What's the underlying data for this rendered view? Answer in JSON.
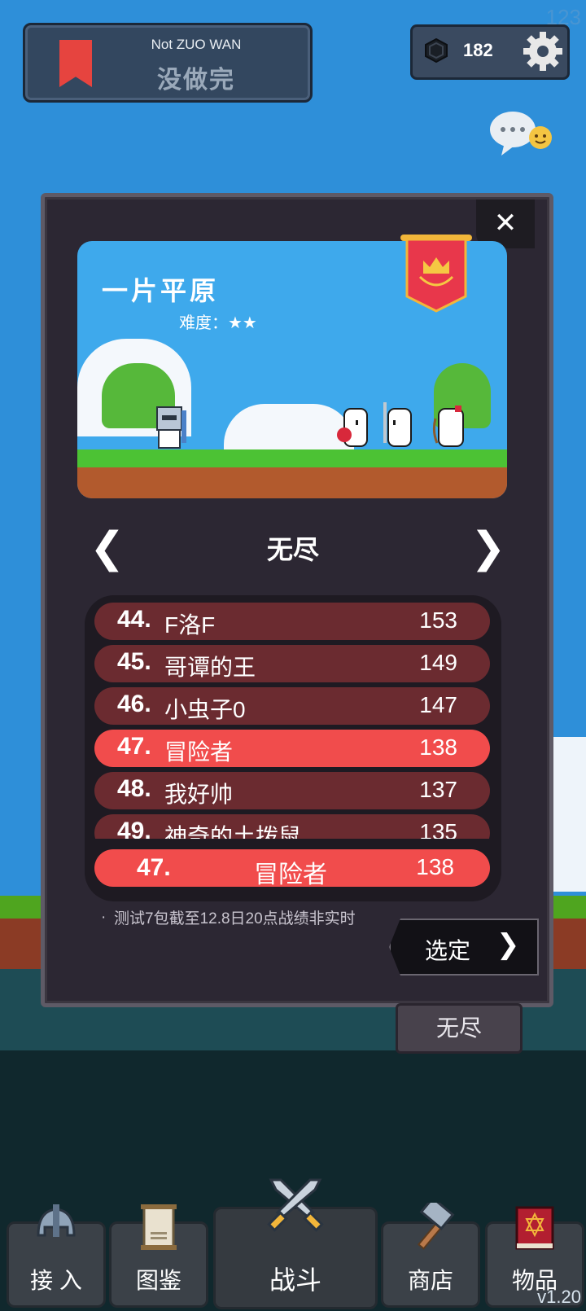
{
  "header": {
    "title_en": "Not ZUO WAN",
    "title_zh": "没做完",
    "gem_count": "182",
    "corner_number": "123"
  },
  "stage": {
    "name": "一片平原",
    "difficulty_label": "难度：",
    "difficulty_stars": "★★"
  },
  "mode": {
    "title": "无尽",
    "prev_symbol": "❮",
    "next_symbol": "❯"
  },
  "leaderboard": {
    "rows": [
      {
        "rank": "44.",
        "name": "F洛F",
        "score": "153",
        "highlight": false
      },
      {
        "rank": "45.",
        "name": "哥谭的王",
        "score": "149",
        "highlight": false
      },
      {
        "rank": "46.",
        "name": "小虫子0",
        "score": "147",
        "highlight": false
      },
      {
        "rank": "47.",
        "name": "冒险者",
        "score": "138",
        "highlight": true
      },
      {
        "rank": "48.",
        "name": "我好帅",
        "score": "137",
        "highlight": false
      },
      {
        "rank": "49.",
        "name": "神奇的土拨鼠",
        "score": "135",
        "highlight": false
      }
    ],
    "me": {
      "rank": "47.",
      "name": "冒险者",
      "score": "138"
    }
  },
  "note": {
    "bullet": "·",
    "text": "测试7包截至12.8日20点战绩非实时"
  },
  "select_button": {
    "label": "选定",
    "arrow": "❯"
  },
  "close_symbol": "✕",
  "mode_tag": "无尽",
  "nav": [
    {
      "label": "接 入",
      "icon": "helmet-icon"
    },
    {
      "label": "图鉴",
      "icon": "scroll-icon"
    },
    {
      "label": "战斗",
      "icon": "crossed-swords-icon"
    },
    {
      "label": "商店",
      "icon": "hammer-icon"
    },
    {
      "label": "物品",
      "icon": "spellbook-icon"
    }
  ],
  "version": "v1.20",
  "colors": {
    "sky": "#2E8FD9",
    "panel": "#2C2733",
    "row": "#6B2B30",
    "row_highlight": "#F14C4C",
    "banner": "#E6443F"
  }
}
